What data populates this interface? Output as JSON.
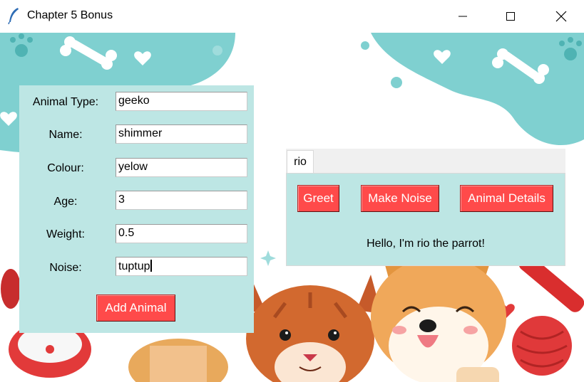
{
  "window": {
    "title": "Chapter 5 Bonus",
    "icon": "feather-icon",
    "controls": [
      "minimize-icon",
      "maximize-icon",
      "close-icon"
    ]
  },
  "form": {
    "fields": [
      {
        "label": "Animal Type:",
        "value": "geeko"
      },
      {
        "label": "Name:",
        "value": "shimmer"
      },
      {
        "label": "Colour:",
        "value": "yelow"
      },
      {
        "label": "Age:",
        "value": "3"
      },
      {
        "label": "Weight:",
        "value": "0.5"
      },
      {
        "label": "Noise:",
        "value": "tuptup"
      }
    ],
    "add_button": "Add Animal"
  },
  "notebook": {
    "tabs": [
      {
        "label": "rio",
        "selected": true
      }
    ],
    "buttons": [
      "Greet",
      "Make Noise",
      "Animal Details"
    ],
    "message": "Hello, I'm rio the parrot!"
  },
  "colors": {
    "panel_bg": "#bde6e4",
    "button_bg": "#ff4a4a",
    "button_text": "#ffffff",
    "bg_teal": "#7fcfcf"
  }
}
